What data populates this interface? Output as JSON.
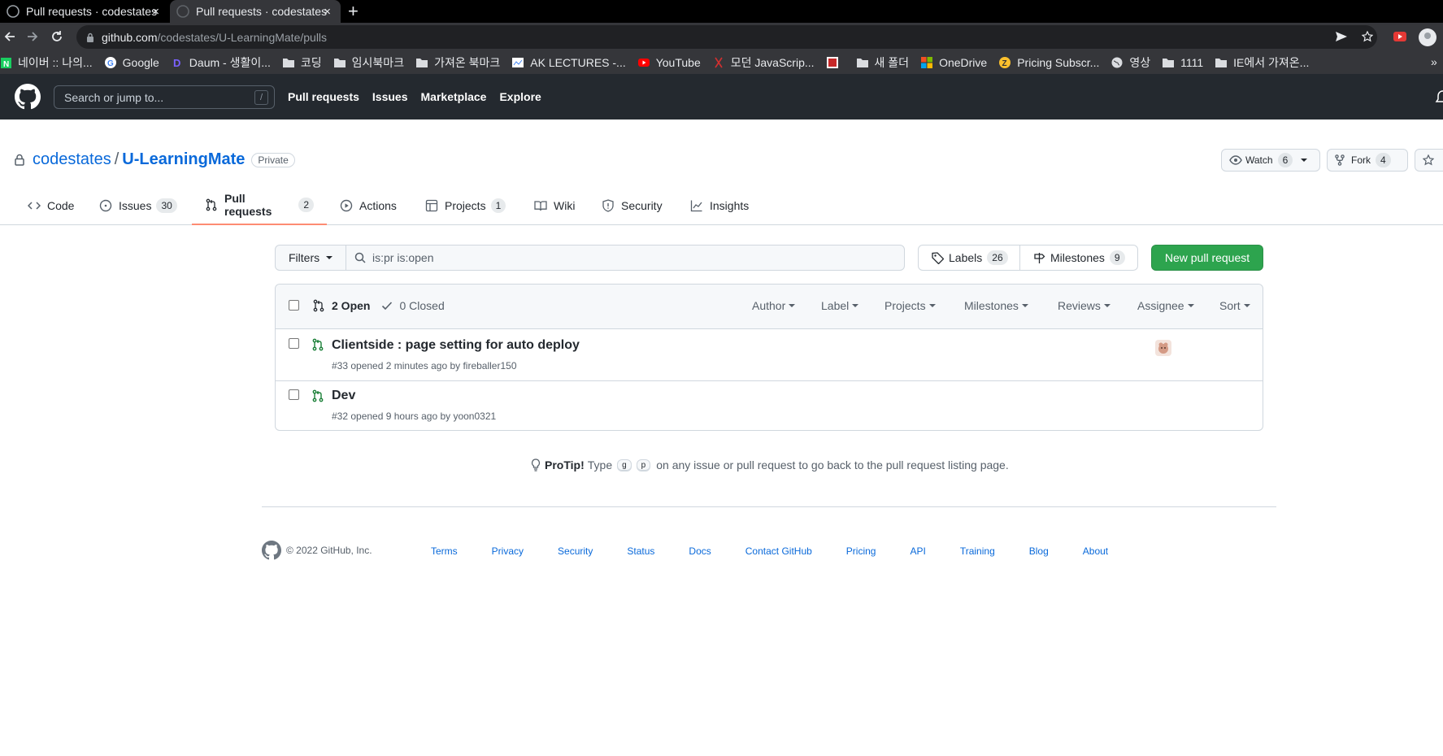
{
  "browser": {
    "tabs": [
      {
        "title": "Pull requests · codestates",
        "active": false
      },
      {
        "title": "Pull requests · codestates",
        "active": true
      }
    ],
    "new_tab_label": "+",
    "close_label": "×",
    "url_host": "github.com",
    "url_path": "/codestates/U-LearningMate/pulls",
    "bookmarks": [
      {
        "label": "네이버 :: 나의...",
        "icon": "naver-icon"
      },
      {
        "label": "Google",
        "icon": "google-icon"
      },
      {
        "label": "Daum - 생활이...",
        "icon": "daum-icon"
      },
      {
        "label": "코딩",
        "icon": "folder-icon"
      },
      {
        "label": "임시북마크",
        "icon": "folder-icon"
      },
      {
        "label": "가져온 북마크",
        "icon": "folder-icon"
      },
      {
        "label": "AK LECTURES -...",
        "icon": "page-icon"
      },
      {
        "label": "YouTube",
        "icon": "youtube-icon"
      },
      {
        "label": "모던 JavaScrip...",
        "icon": "page-icon"
      },
      {
        "label": "",
        "icon": "page-icon"
      },
      {
        "label": "새 폴더",
        "icon": "folder-icon"
      },
      {
        "label": "OneDrive",
        "icon": "microsoft-icon"
      },
      {
        "label": "Pricing Subscr...",
        "icon": "page-icon"
      },
      {
        "label": "영상",
        "icon": "globe-icon"
      },
      {
        "label": "1111",
        "icon": "folder-icon"
      },
      {
        "label": "IE에서 가져온...",
        "icon": "folder-icon"
      }
    ],
    "more_bookmarks": "»"
  },
  "header": {
    "search_placeholder": "Search or jump to...",
    "search_key": "/",
    "nav": [
      "Pull requests",
      "Issues",
      "Marketplace",
      "Explore"
    ]
  },
  "repo": {
    "owner": "codestates",
    "separator": "/",
    "name": "U-LearningMate",
    "visibility": "Private",
    "watch_label": "Watch",
    "watch_count": "6",
    "fork_label": "Fork",
    "fork_count": "4"
  },
  "repo_nav": [
    {
      "label": "Code",
      "count": ""
    },
    {
      "label": "Issues",
      "count": "30"
    },
    {
      "label": "Pull requests",
      "count": "2"
    },
    {
      "label": "Actions",
      "count": ""
    },
    {
      "label": "Projects",
      "count": "1"
    },
    {
      "label": "Wiki",
      "count": ""
    },
    {
      "label": "Security",
      "count": ""
    },
    {
      "label": "Insights",
      "count": ""
    }
  ],
  "subnav": {
    "filters_label": "Filters",
    "search_value": "is:pr is:open",
    "labels_label": "Labels",
    "labels_count": "26",
    "milestones_label": "Milestones",
    "milestones_count": "9",
    "new_pr_label": "New pull request"
  },
  "list": {
    "open_label": "2 Open",
    "closed_label": "0 Closed",
    "sort_menus": [
      "Author",
      "Label",
      "Projects",
      "Milestones",
      "Reviews",
      "Assignee",
      "Sort"
    ],
    "items": [
      {
        "title": "Clientside : page setting for auto deploy",
        "meta": "#33 opened 2 minutes ago by fireballer150"
      },
      {
        "title": "Dev",
        "meta": "#32 opened 9 hours ago by yoon0321"
      }
    ]
  },
  "protip": {
    "bold": "ProTip!",
    "before": "Type",
    "key1": "g",
    "key2": "p",
    "after": "on any issue or pull request to go back to the pull request listing page."
  },
  "footer": {
    "copyright": "© 2022 GitHub, Inc.",
    "links": [
      "Terms",
      "Privacy",
      "Security",
      "Status",
      "Docs",
      "Contact GitHub",
      "Pricing",
      "API",
      "Training",
      "Blog",
      "About"
    ]
  },
  "colors": {
    "accent": "#0969da",
    "open_green": "#1a7f37",
    "new_pr_button": "#2da44e",
    "selected_tab_underline": "#fd8c73",
    "header_bg": "#24292f"
  }
}
